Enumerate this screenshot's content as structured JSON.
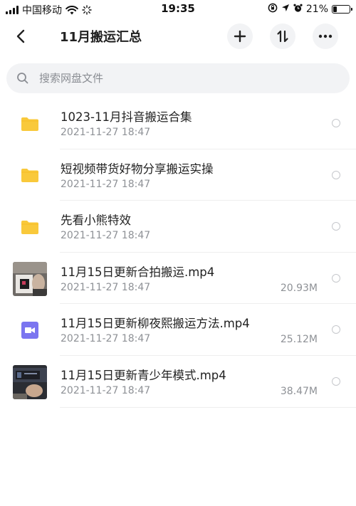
{
  "status_bar": {
    "carrier": "中国移动",
    "time": "19:35",
    "battery_percent": "21%",
    "battery_level": 0.21
  },
  "nav": {
    "title": "11月搬运汇总",
    "icons": [
      "back-icon",
      "add-icon",
      "sort-icon",
      "more-icon"
    ]
  },
  "search": {
    "placeholder": "搜索网盘文件",
    "value": ""
  },
  "files": [
    {
      "name": "1023-11月抖音搬运合集",
      "date": "2021-11-27 18:47",
      "size": "",
      "kind": "folder"
    },
    {
      "name": "短视频带货好物分享搬运实操",
      "date": "2021-11-27 18:47",
      "size": "",
      "kind": "folder"
    },
    {
      "name": "先看小熊特效",
      "date": "2021-11-27 18:47",
      "size": "",
      "kind": "folder"
    },
    {
      "name": "11月15日更新合拍搬运.mp4",
      "date": "2021-11-27 18:47",
      "size": "20.93M",
      "kind": "video-thumbnail"
    },
    {
      "name": "11月15日更新柳夜熙搬运方法.mp4",
      "date": "2021-11-27 18:47",
      "size": "25.12M",
      "kind": "video-icon"
    },
    {
      "name": "11月15日更新青少年模式.mp4",
      "date": "2021-11-27 18:47",
      "size": "38.47M",
      "kind": "video-thumbnail"
    }
  ],
  "colors": {
    "folder": "#f9c93b",
    "video_icon": "#7b75f0",
    "meta_text": "#8e9196",
    "search_bg": "#f2f3f5"
  }
}
